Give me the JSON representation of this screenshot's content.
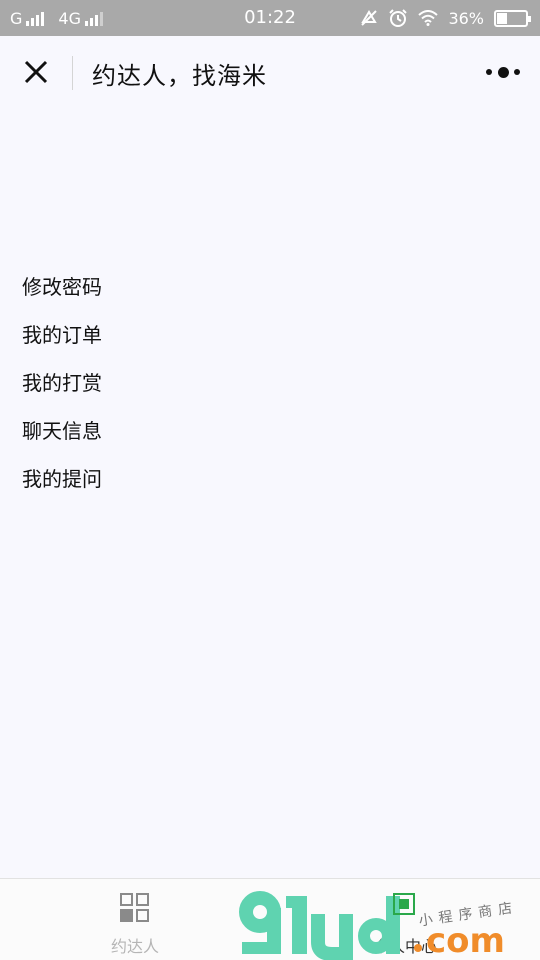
{
  "status_bar": {
    "carrier1": "G",
    "carrier2": "4G",
    "time": "01:22",
    "battery": "36%",
    "battery_level": 0.36,
    "icons": [
      "signal-icon",
      "mute-icon",
      "alarm-icon",
      "wifi-icon",
      "battery-icon"
    ]
  },
  "header": {
    "title": "约达人，找海米",
    "close_icon": "close-icon",
    "more_icon": "more-icon"
  },
  "menu": {
    "items": [
      {
        "label": "修改密码"
      },
      {
        "label": "我的订单"
      },
      {
        "label": "我的打赏"
      },
      {
        "label": "聊天信息"
      },
      {
        "label": "我的提问"
      }
    ]
  },
  "tabbar": {
    "tabs": [
      {
        "label": "约达人",
        "icon": "grid-icon",
        "active": false
      },
      {
        "label": "个人中心",
        "icon": "person-icon",
        "active": true
      }
    ]
  },
  "watermark": {
    "text": "91ud.com",
    "subtext": "小程序商店"
  },
  "colors": {
    "status_bar_bg": "#a9a9a9",
    "page_bg": "#f8f8fe",
    "watermark_green": "#5fd3b0",
    "watermark_orange": "#f08c2a"
  }
}
